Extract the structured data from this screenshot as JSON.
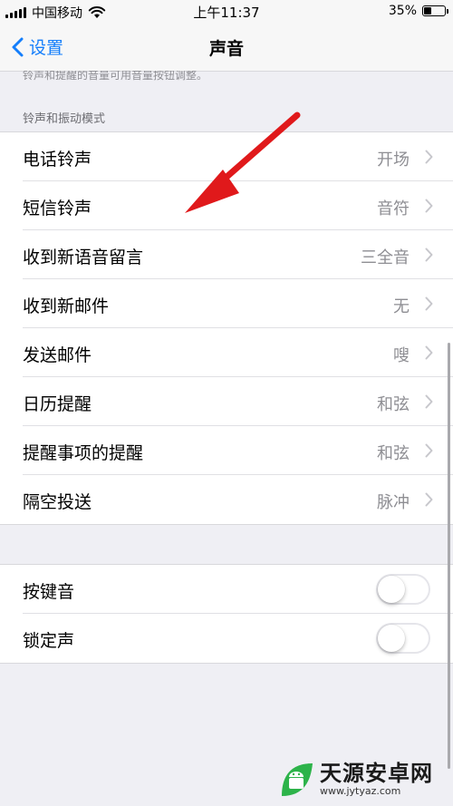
{
  "status_bar": {
    "carrier": "中国移动",
    "time": "上午11:37",
    "battery_text": "35%",
    "battery_level": 0.35
  },
  "nav": {
    "back_label": "设置",
    "title": "声音"
  },
  "hint_text": "铃声和提醒的音量可用音量按钮调整。",
  "section_header": "铃声和振动模式",
  "sound_rows": [
    {
      "label": "电话铃声",
      "value": "开场"
    },
    {
      "label": "短信铃声",
      "value": "音符"
    },
    {
      "label": "收到新语音留言",
      "value": "三全音"
    },
    {
      "label": "收到新邮件",
      "value": "无"
    },
    {
      "label": "发送邮件",
      "value": "嗖"
    },
    {
      "label": "日历提醒",
      "value": "和弦"
    },
    {
      "label": "提醒事项的提醒",
      "value": "和弦"
    },
    {
      "label": "隔空投送",
      "value": "脉冲"
    }
  ],
  "toggle_rows": [
    {
      "label": "按键音",
      "on": false
    },
    {
      "label": "锁定声",
      "on": false
    }
  ],
  "watermark": {
    "name": "天源安卓网",
    "url": "www.jytyaz.com"
  },
  "colors": {
    "accent": "#147efb",
    "arrow": "#e0191b",
    "background": "#efeff4",
    "watermark_green": "#2db34a"
  }
}
